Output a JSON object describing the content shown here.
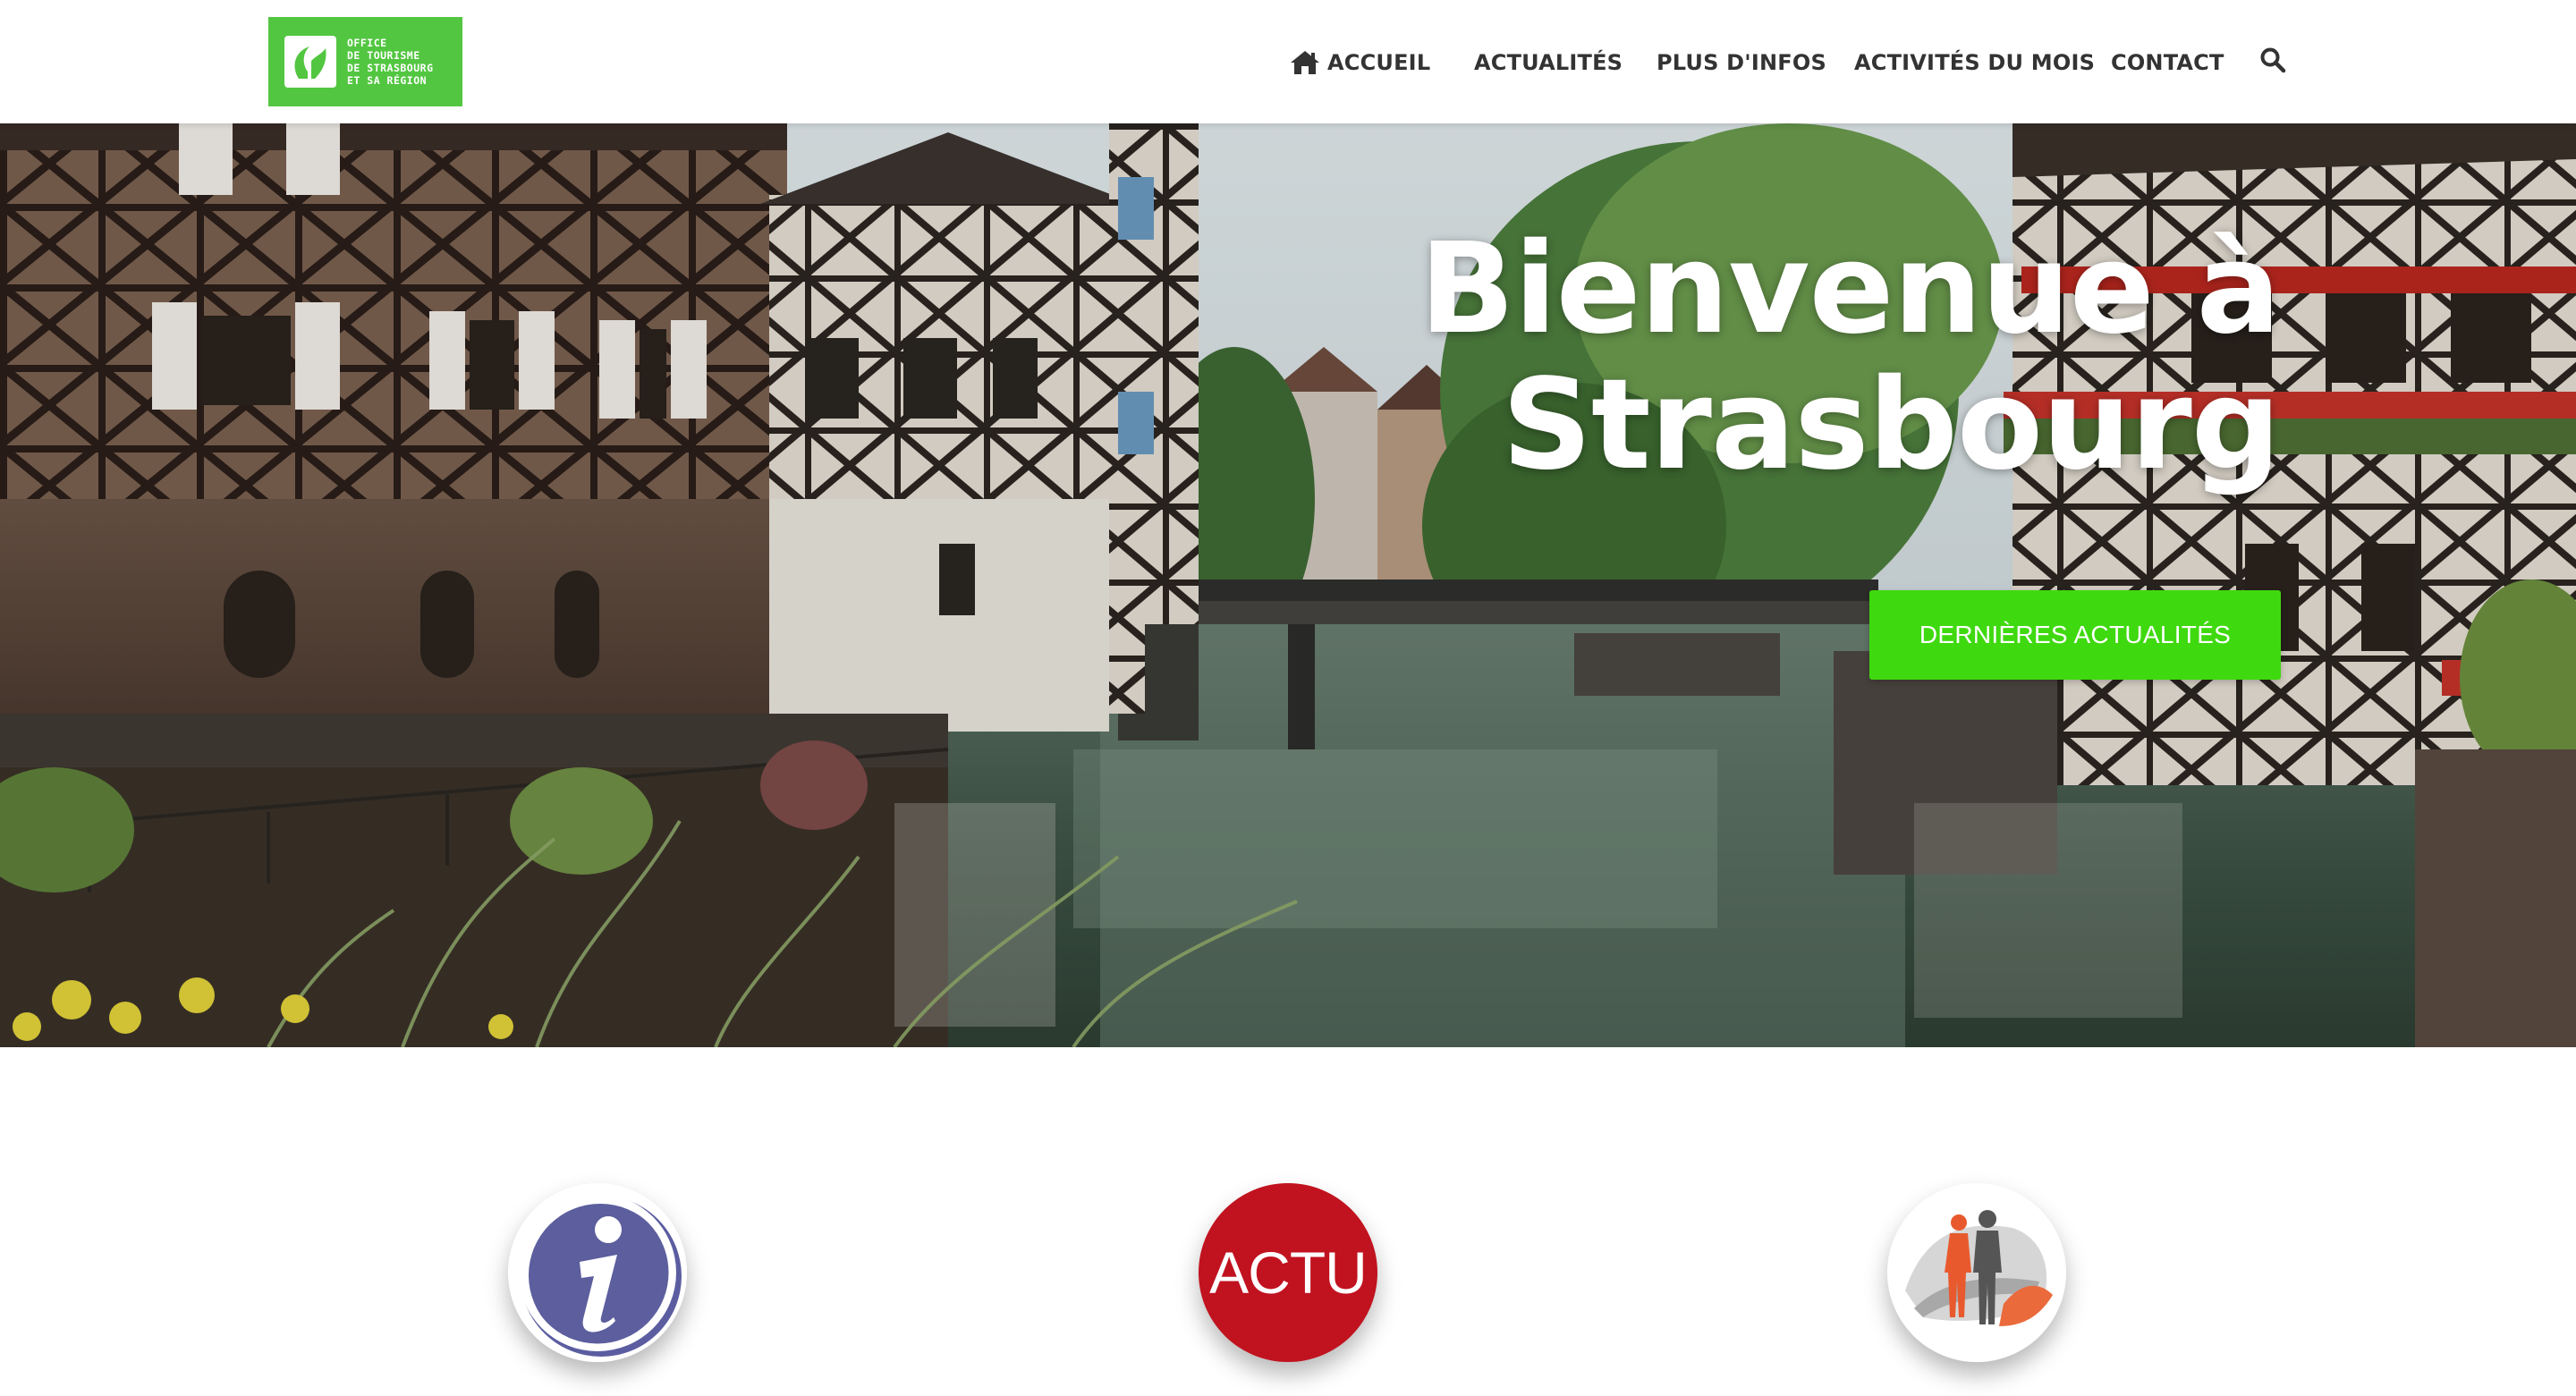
{
  "brand": {
    "logo_lines": [
      "OFFICE",
      "DE TOURISME",
      "DE STRASBOURG",
      "ET SA RÉGION"
    ],
    "logo_color": "#53c641"
  },
  "nav": {
    "items": [
      {
        "label": "ACCUEIL",
        "icon": "home-icon"
      },
      {
        "label": "ACTUALITÉS"
      },
      {
        "label": "PLUS D'INFOS"
      },
      {
        "label": "ACTIVITÉS DU MOIS"
      },
      {
        "label": "CONTACT"
      }
    ],
    "search_icon": "search-icon"
  },
  "hero": {
    "title_line1": "Bienvenue à",
    "title_line2": "Strasbourg",
    "button_label": "DERNIÈRES ACTUALITÉS",
    "button_color": "#3fd90f"
  },
  "features": [
    {
      "name": "info",
      "icon": "info-icon"
    },
    {
      "name": "actu",
      "label": "ACTU",
      "color": "#c1121f"
    },
    {
      "name": "activites",
      "icon": "people-icon"
    }
  ]
}
